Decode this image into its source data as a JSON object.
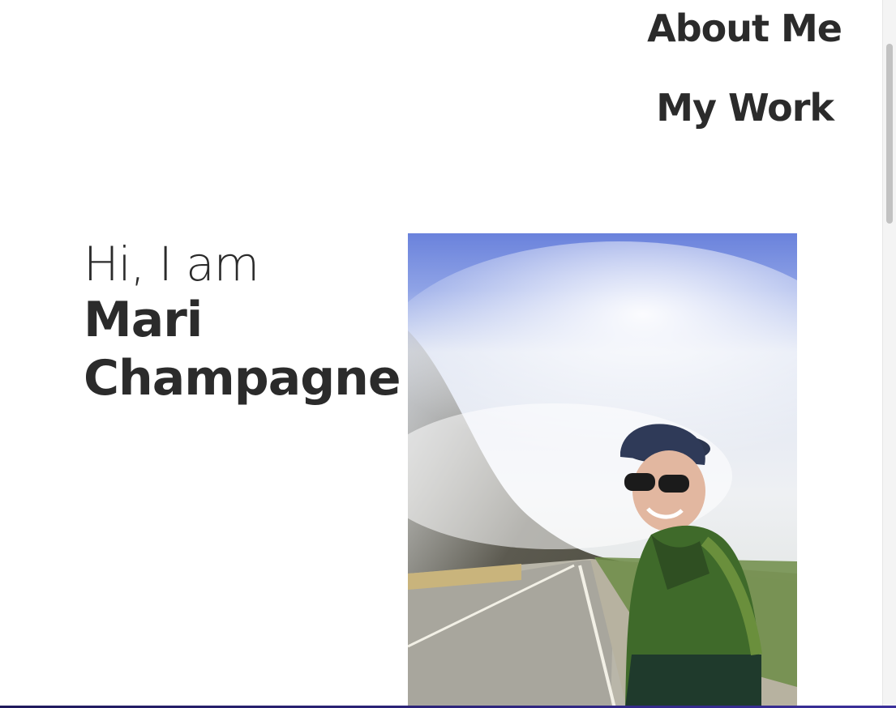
{
  "nav": {
    "about_label": "About Me",
    "work_label": "My Work"
  },
  "hero": {
    "greeting": "Hi, I am",
    "name_line1": "Mari",
    "name_line2": "Champagne"
  },
  "photo": {
    "icon": "portrait-photo"
  },
  "colors": {
    "text": "#2b2b2b",
    "background": "#ffffff",
    "sky": "#6f86dd",
    "jacket": "#3e6b2a"
  }
}
